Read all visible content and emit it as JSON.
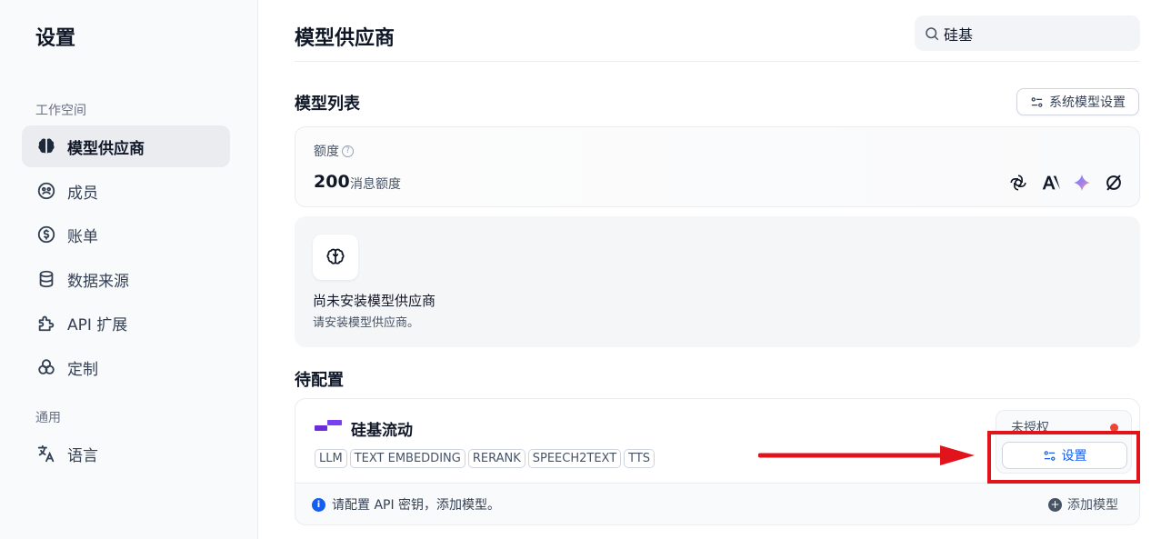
{
  "sidebar": {
    "title": "设置",
    "workspace_label": "工作空间",
    "general_label": "通用",
    "items": [
      {
        "label": "模型供应商",
        "icon": "brain-icon",
        "active": true
      },
      {
        "label": "成员",
        "icon": "members-icon"
      },
      {
        "label": "账单",
        "icon": "billing-icon"
      },
      {
        "label": "数据来源",
        "icon": "database-icon"
      },
      {
        "label": "API 扩展",
        "icon": "puzzle-icon"
      },
      {
        "label": "定制",
        "icon": "customize-icon"
      }
    ],
    "general_items": [
      {
        "label": "语言",
        "icon": "language-icon"
      }
    ]
  },
  "header": {
    "title": "模型供应商",
    "search_value": "硅基"
  },
  "model_list": {
    "title": "模型列表",
    "system_settings_button": "系统模型设置",
    "quota": {
      "label": "额度",
      "help": "?",
      "value": "200",
      "unit": "消息额度",
      "provider_icons": [
        "openai-icon",
        "anthropic-icon",
        "gemini-icon",
        "other-provider-icon"
      ]
    },
    "empty": {
      "title": "尚未安装模型供应商",
      "subtitle": "请安装模型供应商。"
    }
  },
  "pending": {
    "title": "待配置",
    "provider": {
      "name": "硅基流动",
      "tags": [
        "LLM",
        "TEXT EMBEDDING",
        "RERANK",
        "SPEECH2TEXT",
        "TTS"
      ],
      "status": "未授权",
      "status_color": "#f04438",
      "settings_button": "设置",
      "info_text": "请配置 API 密钥，添加模型。",
      "add_model": "添加模型"
    }
  },
  "colors": {
    "accent": "#155eef",
    "annotation": "#e1131b",
    "provider_logo": "#6c2bd9"
  }
}
